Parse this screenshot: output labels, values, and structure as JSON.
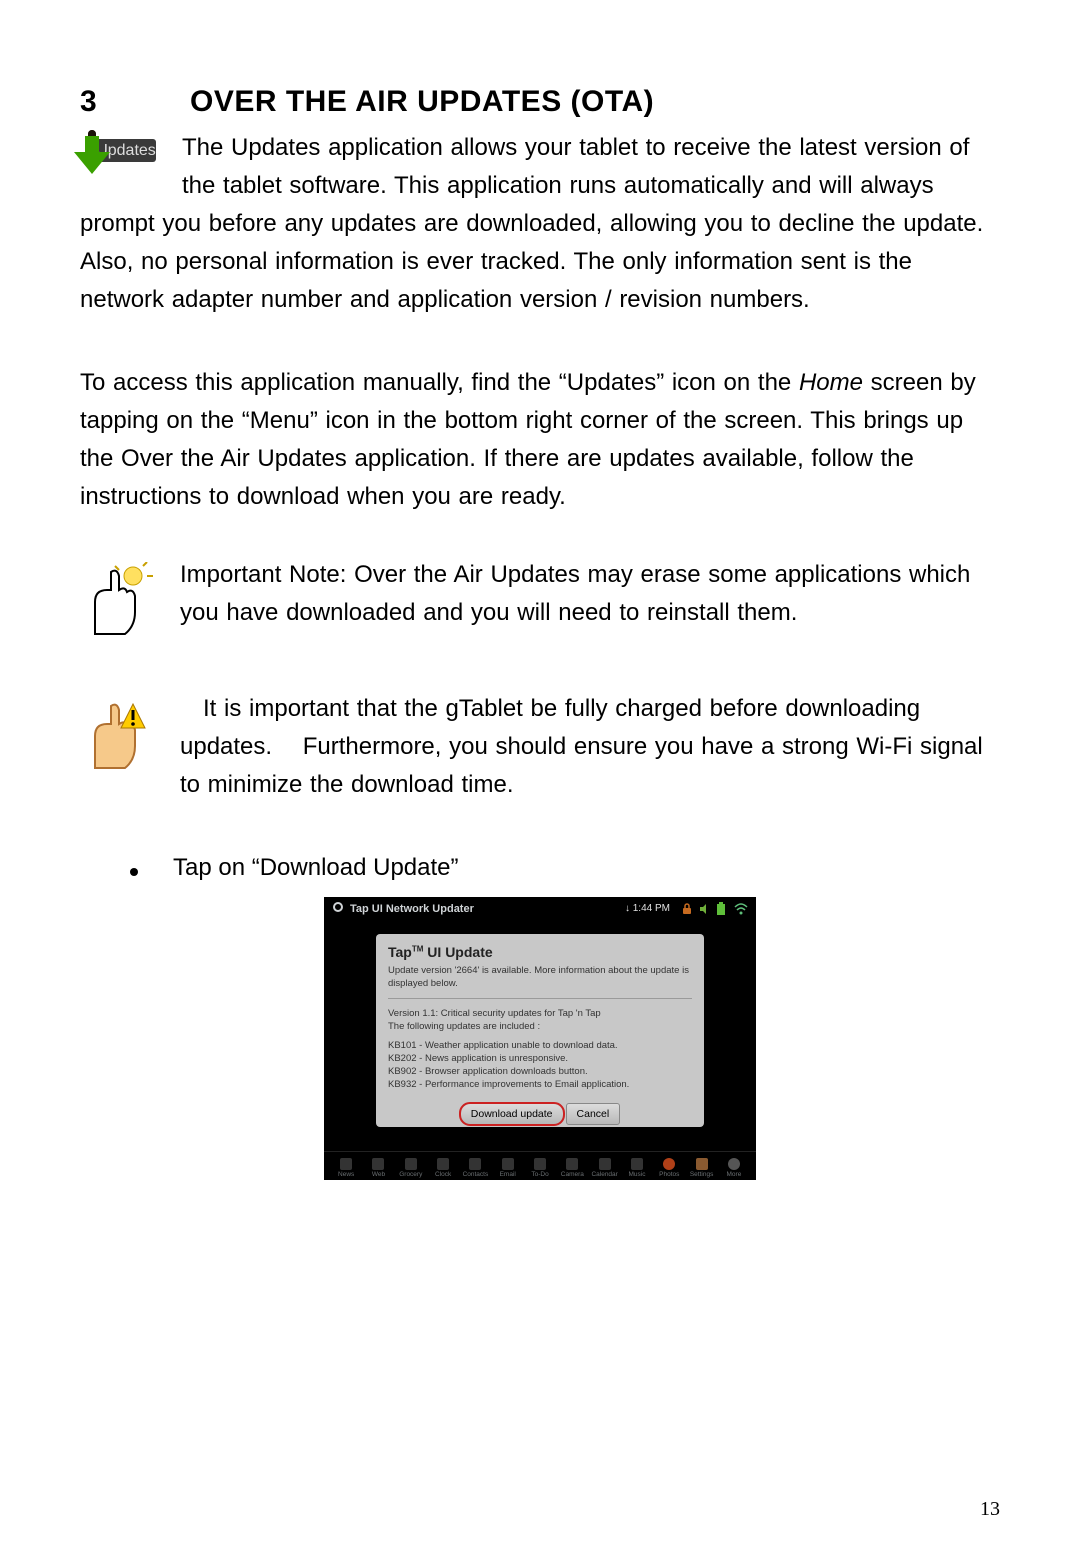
{
  "section": {
    "number": "3",
    "title": "OVER THE AIR UPDATES (OTA)"
  },
  "updates_icon": {
    "glyph": "download-box",
    "label": "Updates"
  },
  "paragraph1": "The Updates application allows your tablet to receive the latest version of the tablet software.    This application runs automatically and will always prompt you before any updates are downloaded, allowing you to decline the update.    Also, no personal information is ever tracked.    The only information sent is the network adapter number and application version / revision numbers.",
  "paragraph2_a": "To access this application manually, find the “Updates” icon on the ",
  "paragraph2_b_italic": "Home",
  "paragraph2_c": " screen by tapping on the “Menu” icon in the bottom right corner of the screen.    This brings up the Over the Air Updates application.    If there are updates available, follow the instructions to download when you are ready.",
  "note1": {
    "icon": "hand-lightbulb",
    "text": "Important Note: Over the Air Updates may erase some applications which you have downloaded and you will need to reinstall them."
  },
  "note2": {
    "icon": "hand-warning",
    "text": "   It is important that the gTablet be fully charged before downloading updates.    Furthermore, you should ensure you have a strong Wi-Fi signal to minimize the download time."
  },
  "bullet1": "Tap on “Download Update”",
  "tablet": {
    "app_title": "Tap UI Network Updater",
    "time": "↓ 1:44 PM",
    "status_icons": [
      "lock-icon",
      "volume-icon",
      "battery-icon",
      "wifi-icon"
    ],
    "card": {
      "title_before": "Tap",
      "title_tm": "TM",
      "title_after": " UI Update",
      "desc": "Update version '2664' is available. More information about the update is displayed below.",
      "version_line": "Version 1.1: Critical security updates for Tap 'n Tap",
      "following_line": "The following updates are included :",
      "kb_lines": [
        "KB101 - Weather application unable to download data.",
        "KB202 - News application is unresponsive.",
        "KB902 - Browser application downloads button.",
        "KB932 - Performance improvements to Email application."
      ],
      "download_btn": "Download update",
      "cancel_btn": "Cancel"
    },
    "nav": [
      "News",
      "Web",
      "Grocery",
      "Clock",
      "Contacts",
      "Email",
      "To-Do",
      "Camera",
      "Calendar",
      "Music",
      "Photos",
      "Settings",
      "More"
    ]
  },
  "page_number": "13"
}
